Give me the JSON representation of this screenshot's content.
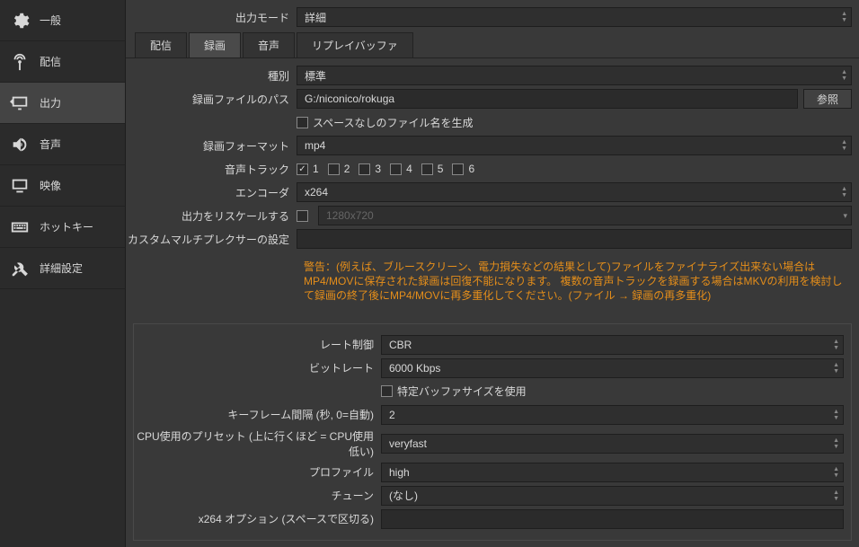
{
  "sidebar": {
    "items": [
      {
        "label": "一般",
        "icon": "gear"
      },
      {
        "label": "配信",
        "icon": "antenna"
      },
      {
        "label": "出力",
        "icon": "monitor-arrow"
      },
      {
        "label": "音声",
        "icon": "speaker"
      },
      {
        "label": "映像",
        "icon": "monitor"
      },
      {
        "label": "ホットキー",
        "icon": "keyboard"
      },
      {
        "label": "詳細設定",
        "icon": "tools"
      }
    ]
  },
  "outputMode": {
    "label": "出力モード",
    "value": "詳細"
  },
  "tabs": [
    "配信",
    "録画",
    "音声",
    "リプレイバッファ"
  ],
  "activeTab": "録画",
  "type": {
    "label": "種別",
    "value": "標準"
  },
  "path": {
    "label": "録画ファイルのパス",
    "value": "G:/niconico/rokuga",
    "button": "参照"
  },
  "noSpace": {
    "label": "スペースなしのファイル名を生成",
    "checked": false
  },
  "format": {
    "label": "録画フォーマット",
    "value": "mp4"
  },
  "tracks": {
    "label": "音声トラック",
    "items": [
      {
        "n": "1",
        "checked": true
      },
      {
        "n": "2",
        "checked": false
      },
      {
        "n": "3",
        "checked": false
      },
      {
        "n": "4",
        "checked": false
      },
      {
        "n": "5",
        "checked": false
      },
      {
        "n": "6",
        "checked": false
      }
    ]
  },
  "encoder": {
    "label": "エンコーダ",
    "value": "x264"
  },
  "rescale": {
    "label": "出力をリスケールする",
    "checked": false,
    "value": "1280x720"
  },
  "muxer": {
    "label": "カスタムマルチプレクサーの設定",
    "value": ""
  },
  "warning": "警告：(例えば、ブルースクリーン、電力損失などの結果として)ファイルをファイナライズ出来ない場合はMP4/MOVに保存された録画は回復不能になります。 複数の音声トラックを録画する場合はMKVの利用を検討して録画の終了後にMP4/MOVに再多重化してください。(ファイル → 録画の再多重化)",
  "rateControl": {
    "label": "レート制御",
    "value": "CBR"
  },
  "bitrate": {
    "label": "ビットレート",
    "value": "6000 Kbps"
  },
  "customBuf": {
    "label": "特定バッファサイズを使用",
    "checked": false
  },
  "keyframe": {
    "label": "キーフレーム間隔 (秒, 0=自動)",
    "value": "2"
  },
  "cpuPreset": {
    "label": "CPU使用のプリセット (上に行くほど = CPU使用低い)",
    "value": "veryfast"
  },
  "profile": {
    "label": "プロファイル",
    "value": "high"
  },
  "tune": {
    "label": "チューン",
    "value": "(なし)"
  },
  "x264opts": {
    "label": "x264 オプション (スペースで区切る)",
    "value": ""
  }
}
